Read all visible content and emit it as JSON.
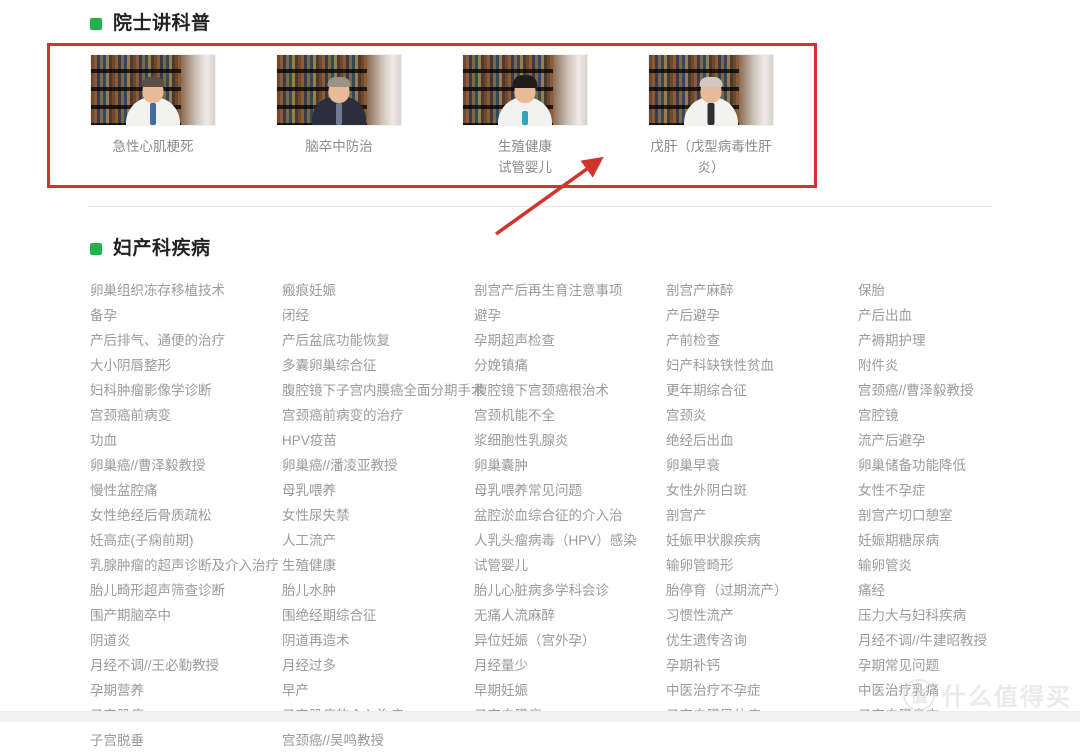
{
  "sections": [
    {
      "id": "yuanshi",
      "bullet_color": "#21b34a",
      "title": "院士讲科普"
    },
    {
      "id": "fuchan",
      "bullet_color": "#21b34a",
      "title": "妇产科疾病"
    }
  ],
  "cards": [
    {
      "title": "急性心肌梗死",
      "thumb": "doctor-portrait-thumbnail"
    },
    {
      "title": "脑卒中防治",
      "thumb": "doctor-portrait-thumbnail"
    },
    {
      "title": "生殖健康\n试管婴儿",
      "title_line1": "生殖健康",
      "title_line2": "试管婴儿",
      "thumb": "doctor-portrait-thumbnail"
    },
    {
      "title": "戊肝（戊型病毒性肝炎）",
      "title_line1": "戊肝（戊型病毒性肝",
      "title_line2": "炎）",
      "thumb": "doctor-portrait-thumbnail"
    }
  ],
  "annotations": {
    "rectangle_color": "#d0342c",
    "arrow_color": "#d0342c"
  },
  "topic_columns": [
    {
      "items": [
        "卵巢组织冻存移植技术",
        "备孕",
        "产后排气、通便的治疗",
        "大小阴唇整形",
        "妇科肿瘤影像学诊断",
        "宫颈癌前病变",
        "功血",
        "卵巢癌//曹泽毅教授",
        "慢性盆腔痛",
        "女性绝经后骨质疏松",
        "妊高症(子痫前期)",
        "乳腺肿瘤的超声诊断及介入治疗",
        "胎儿畸形超声筛查诊断",
        "围产期脑卒中",
        "阴道炎",
        "月经不调//王必勤教授",
        "孕期营养",
        "子宫肌瘤",
        "子宫脱垂"
      ]
    },
    {
      "items": [
        "瘢痕妊娠",
        "闭经",
        "产后盆底功能恢复",
        "多囊卵巢综合征",
        "腹腔镜下子宫内膜癌全面分期手术",
        "宫颈癌前病变的治疗",
        "HPV疫苗",
        "卵巢癌//潘凌亚教授",
        "母乳喂养",
        "女性尿失禁",
        "人工流产",
        "生殖健康",
        "胎儿水肿",
        "围绝经期综合征",
        "阴道再造术",
        "月经过多",
        "早产",
        "子宫肌瘤的介入治疗",
        "宫颈癌//吴鸣教授"
      ]
    },
    {
      "items": [
        "剖宫产后再生育注意事项",
        "避孕",
        "孕期超声检查",
        "分娩镇痛",
        "腹腔镜下宫颈癌根治术",
        "宫颈机能不全",
        "浆细胞性乳腺炎",
        "卵巢囊肿",
        "母乳喂养常见问题",
        "盆腔淤血综合征的介入治",
        "人乳头瘤病毒（HPV）感染",
        "试管婴儿",
        "胎儿心脏病多学科会诊",
        "无痛人流麻醉",
        "异位妊娠（宫外孕）",
        "月经量少",
        "早期妊娠",
        "子宫内膜癌"
      ]
    },
    {
      "items": [
        "剖宫产麻醉",
        "产后避孕",
        "产前检查",
        "妇产科缺铁性贫血",
        "更年期综合征",
        "宫颈炎",
        "绝经后出血",
        "卵巢早衰",
        "女性外阴白斑",
        "剖宫产",
        "妊娠甲状腺疾病",
        "输卵管畸形",
        "胎停育（过期流产）",
        "习惯性流产",
        "优生遗传咨询",
        "孕期补钙",
        "中医治疗不孕症",
        "子宫内膜异位症"
      ]
    },
    {
      "items": [
        "保胎",
        "产后出血",
        "产褥期护理",
        "附件炎",
        "宫颈癌//曹泽毅教授",
        "宫腔镜",
        "流产后避孕",
        "卵巢储备功能降低",
        "女性不孕症",
        "剖宫产切口憩室",
        "妊娠期糖尿病",
        "输卵管炎",
        "痛经",
        "压力大与妇科疾病",
        "月经不调//牛建昭教授",
        "孕期常见问题",
        "中医治疗乳痛",
        "子宫内膜息肉"
      ]
    }
  ],
  "watermark": {
    "badge": "值",
    "text": "什么值得买"
  }
}
